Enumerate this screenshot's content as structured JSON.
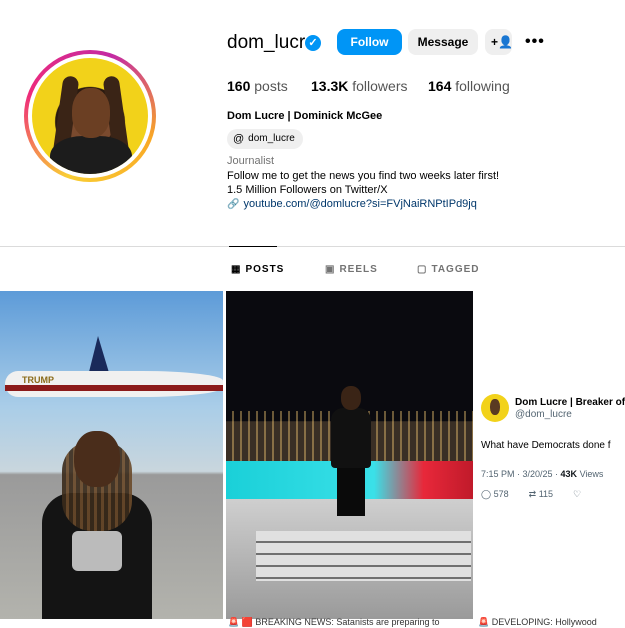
{
  "profile": {
    "username": "dom_lucre",
    "follow_label": "Follow",
    "message_label": "Message",
    "posts_count": "160",
    "posts_label": "posts",
    "followers_count": "13.3K",
    "followers_label": "followers",
    "following_count": "164",
    "following_label": "following",
    "full_name": "Dom Lucre | Dominick McGee",
    "threads_handle": "dom_lucre",
    "category": "Journalist",
    "bio_line1": "Follow me to get the news you find two weeks later first!",
    "bio_line2": "1.5 Million Followers on Twitter/X",
    "link": "youtube.com/@domlucre?si=FVjNaiRNPtIPd9jq"
  },
  "tabs": [
    {
      "label": "POSTS",
      "icon": "grid-icon",
      "active": true
    },
    {
      "label": "REELS",
      "icon": "reels-icon",
      "active": false
    },
    {
      "label": "TAGGED",
      "icon": "tagged-icon",
      "active": false
    }
  ],
  "posts": {
    "post1": {
      "plane_text": "TRUMP"
    },
    "post3": {
      "name": "Dom Lucre | Breaker of N",
      "handle": "@dom_lucre",
      "text": "What have Democrats done f",
      "time": "7:15 PM · 3/20/25 · ",
      "views_count": "43K",
      "views_label": "Views",
      "replies": "578",
      "reposts": "115"
    }
  },
  "bottom_strip": {
    "item1": "🚨 🟥 BREAKING NEWS: Satanists are preparing to",
    "item2": "🚨 DEVELOPING: Hollywood"
  },
  "colors": {
    "accent": "#0095f6",
    "link": "#00376b"
  }
}
